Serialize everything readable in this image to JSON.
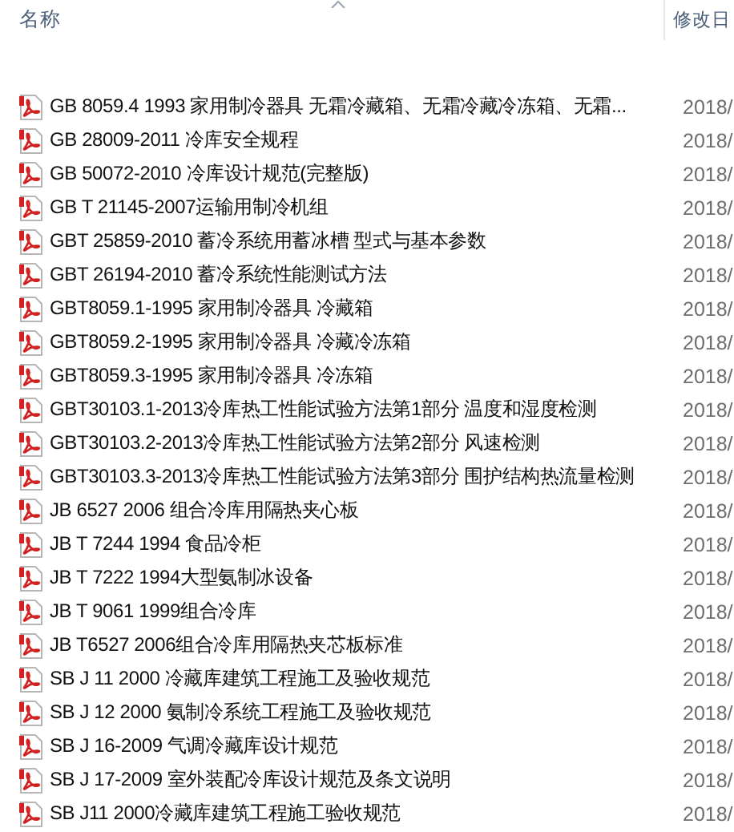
{
  "columns": [
    {
      "label": "名称",
      "sorted": true
    },
    {
      "label": "修改日"
    }
  ],
  "rows": [
    {
      "name": "GB 8059.4 1993 家用制冷器具 无霜冷藏箱、无霜冷藏冷冻箱、无霜...",
      "date": "2018/"
    },
    {
      "name": "GB 28009-2011 冷库安全规程",
      "date": "2018/"
    },
    {
      "name": "GB 50072-2010 冷库设计规范(完整版)",
      "date": "2018/"
    },
    {
      "name": "GB T 21145-2007运输用制冷机组",
      "date": "2018/"
    },
    {
      "name": "GBT 25859-2010 蓄冷系统用蓄冰槽 型式与基本参数",
      "date": "2018/"
    },
    {
      "name": "GBT 26194-2010 蓄冷系统性能测试方法",
      "date": "2018/"
    },
    {
      "name": "GBT8059.1-1995 家用制冷器具 冷藏箱",
      "date": "2018/"
    },
    {
      "name": "GBT8059.2-1995 家用制冷器具 冷藏冷冻箱",
      "date": "2018/"
    },
    {
      "name": "GBT8059.3-1995 家用制冷器具 冷冻箱",
      "date": "2018/"
    },
    {
      "name": "GBT30103.1-2013冷库热工性能试验方法第1部分 温度和湿度检测",
      "date": "2018/"
    },
    {
      "name": "GBT30103.2-2013冷库热工性能试验方法第2部分 风速检测",
      "date": "2018/"
    },
    {
      "name": "GBT30103.3-2013冷库热工性能试验方法第3部分 围护结构热流量检测",
      "date": "2018/"
    },
    {
      "name": "JB 6527 2006 组合冷库用隔热夹心板",
      "date": "2018/"
    },
    {
      "name": "JB T  7244 1994 食品冷柜",
      "date": "2018/"
    },
    {
      "name": "JB T 7222 1994大型氨制冰设备",
      "date": "2018/"
    },
    {
      "name": "JB T 9061 1999组合冷库",
      "date": "2018/"
    },
    {
      "name": "JB T6527 2006组合冷库用隔热夹芯板标准",
      "date": "2018/"
    },
    {
      "name": "SB J 11 2000 冷藏库建筑工程施工及验收规范",
      "date": "2018/"
    },
    {
      "name": "SB J 12  2000 氨制冷系统工程施工及验收规范",
      "date": "2018/"
    },
    {
      "name": "SB J 16-2009 气调冷藏库设计规范",
      "date": "2018/"
    },
    {
      "name": "SB J 17-2009 室外装配冷库设计规范及条文说明",
      "date": "2018/"
    },
    {
      "name": "SB J11 2000冷藏库建筑工程施工验收规范",
      "date": "2018/"
    }
  ]
}
